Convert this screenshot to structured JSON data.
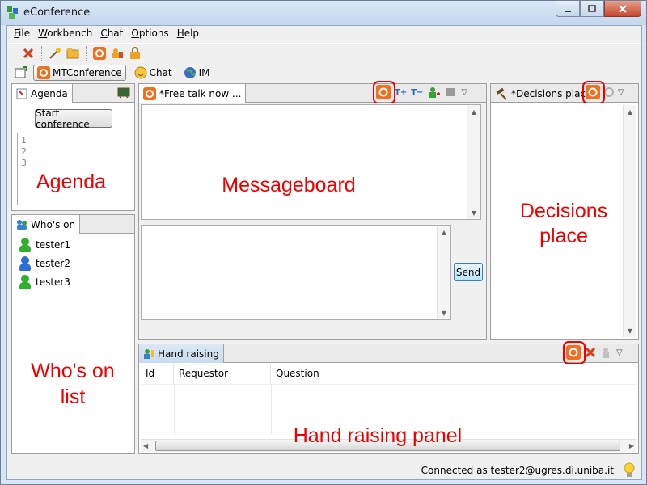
{
  "window": {
    "title": "eConference",
    "blurred_title": "eConference"
  },
  "menubar": {
    "items": [
      {
        "label": "File",
        "mnemonic": "F",
        "rest": "ile"
      },
      {
        "label": "Workbench",
        "mnemonic": "W",
        "rest": "orkbench"
      },
      {
        "label": "Chat",
        "mnemonic": "C",
        "rest": "hat"
      },
      {
        "label": "Options",
        "mnemonic": "O",
        "rest": "ptions"
      },
      {
        "label": "Help",
        "mnemonic": "H",
        "rest": "elp"
      }
    ]
  },
  "perspectives": {
    "mtconference": "MTConference",
    "chat": "Chat",
    "im": "IM"
  },
  "agenda": {
    "tab": "Agenda",
    "start_button": "Start conference",
    "lines": [
      "1",
      "2",
      "3"
    ],
    "overlay": "Agenda"
  },
  "whoson": {
    "tab": "Who's on",
    "users": [
      {
        "name": "tester1",
        "color": "#2fb02f"
      },
      {
        "name": "tester2",
        "color": "#2a6fd6"
      },
      {
        "name": "tester3",
        "color": "#2fb02f"
      }
    ],
    "overlay_line1": "Who's on",
    "overlay_line2": "list"
  },
  "messageboard": {
    "tab": "*Free talk now ...",
    "overlay": "Messageboard",
    "send_button": "Send"
  },
  "decisions": {
    "tab": "*Decisions place",
    "overlay_line1": "Decisions",
    "overlay_line2": "place"
  },
  "handraising": {
    "tab": "Hand raising",
    "columns": [
      "Id",
      "Requestor",
      "Question"
    ],
    "overlay": "Hand raising panel"
  },
  "status": {
    "text": "Connected as tester2@ugres.di.uniba.it"
  },
  "colors": {
    "annotation": "#e00000",
    "accent": "#f07020",
    "selected_tab": "#c9dbee"
  }
}
